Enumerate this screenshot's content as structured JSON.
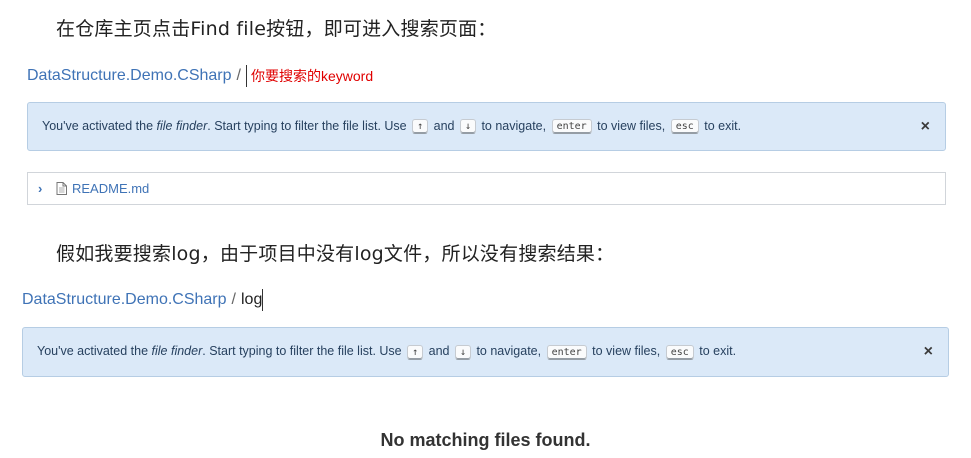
{
  "intro": {
    "text1": "在仓库主页点击Find file按钮，即可进入搜索页面：",
    "text2": "假如我要搜索log，由于项目中没有log文件，所以没有搜索结果："
  },
  "finder1": {
    "repo": "DataStructure.Demo.CSharp",
    "separator": "/",
    "query_hint": "你要搜索的keyword",
    "flash": {
      "pre": "You've activated the ",
      "finder_term": "file finder",
      "mid": ". Start typing to filter the file list. Use ",
      "key_up": "↑",
      "and": " and ",
      "key_down": "↓",
      "to_nav": " to navigate, ",
      "key_enter": "enter",
      "to_view": " to view files, ",
      "key_esc": "esc",
      "to_exit": " to exit.",
      "close": "×"
    },
    "files": [
      {
        "name": "README.md"
      }
    ]
  },
  "finder2": {
    "repo": "DataStructure.Demo.CSharp",
    "separator": "/",
    "query": "log",
    "flash": {
      "pre": "You've activated the ",
      "finder_term": "file finder",
      "mid": ". Start typing to filter the file list. Use ",
      "key_up": "↑",
      "and": " and ",
      "key_down": "↓",
      "to_nav": " to navigate, ",
      "key_enter": "enter",
      "to_view": " to view files, ",
      "key_esc": "esc",
      "to_exit": " to exit.",
      "close": "×"
    },
    "empty_message": "No matching files found."
  },
  "colors": {
    "link": "#3f73b6",
    "flash_bg": "#dbe9f8",
    "hint_red": "#e00000"
  }
}
